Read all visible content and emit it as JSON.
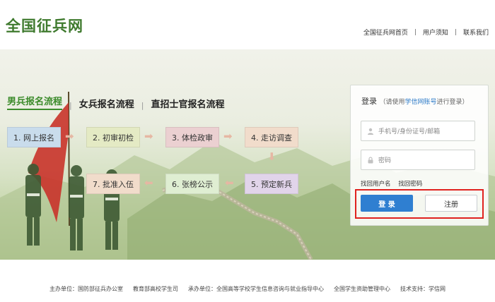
{
  "header": {
    "logo": "全国征兵网",
    "nav": [
      "全国征兵网首页",
      "用户须知",
      "联系我们"
    ]
  },
  "tabs": [
    "男兵报名流程",
    "女兵报名流程",
    "直招士官报名流程"
  ],
  "steps": [
    "1. 网上报名",
    "2. 初审初检",
    "3. 体检政审",
    "4. 走访调查",
    "5. 预定新兵",
    "6. 张榜公示",
    "7. 批准入伍"
  ],
  "login": {
    "title": "登录",
    "note_prefix": "（请使用",
    "note_link": "学信网账号",
    "note_suffix": "进行登录）",
    "username_placeholder": "手机号/身份证号/邮箱",
    "password_placeholder": "密码",
    "find_username": "找回用户名",
    "find_password": "找回密码",
    "login_button": "登 录",
    "register_button": "注册"
  },
  "footer": {
    "host_label": "主办单位：",
    "host_1": "国防部征兵办公室",
    "host_2": "教育部高校学生司",
    "co_label": "承办单位：",
    "co_1": "全国高等学校学生信息咨询与就业指导中心",
    "co_2": "全国学生资助管理中心",
    "support_label": "技术支持：",
    "support": "学信网"
  },
  "colors": {
    "brand_green": "#3f7a2e",
    "tab_active": "#3b8b2a",
    "login_blue": "#2f7fd1",
    "highlight_red": "#e0221f",
    "step_1": "#c9dcec",
    "step_2": "#e4eac4",
    "step_3": "#ebd0d1",
    "step_4": "#f1dccb",
    "step_5": "#e1d4ea",
    "step_6": "#dfeed2",
    "step_7": "#f1dccb"
  }
}
